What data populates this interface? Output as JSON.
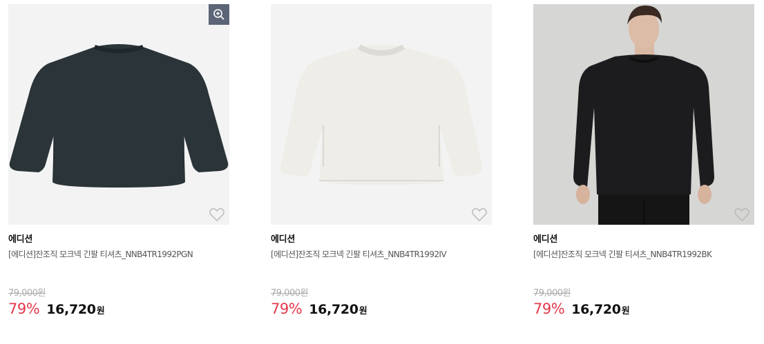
{
  "products": [
    {
      "brand": "에디션",
      "name": "[에디션]잔조직 모크넥 긴팔 티셔츠_NNB4TR1992PGN",
      "original_price": "79,000원",
      "discount_rate": "79%",
      "sale_price": "16,720",
      "currency": "원",
      "color": "#2b3438",
      "has_zoom": true,
      "wishlist_icon": "heart-outline-icon"
    },
    {
      "brand": "에디션",
      "name": "[에디션]잔조직 모크넥 긴팔 티셔츠_NNB4TR1992IV",
      "original_price": "79,000원",
      "discount_rate": "79%",
      "sale_price": "16,720",
      "currency": "원",
      "color": "#eeede8",
      "has_zoom": false,
      "wishlist_icon": "heart-outline-icon"
    },
    {
      "brand": "에디션",
      "name": "[에디션]잔조직 모크넥 긴팔 티셔츠_NNB4TR1992BK",
      "original_price": "79,000원",
      "discount_rate": "79%",
      "sale_price": "16,720",
      "currency": "원",
      "color": "#1c1c1e",
      "has_zoom": false,
      "wishlist_icon": "heart-outline-icon"
    }
  ],
  "colors": {
    "discount": "#e4384a",
    "zoom_button": "#5c6577",
    "image_background": "#f3f3f3"
  }
}
